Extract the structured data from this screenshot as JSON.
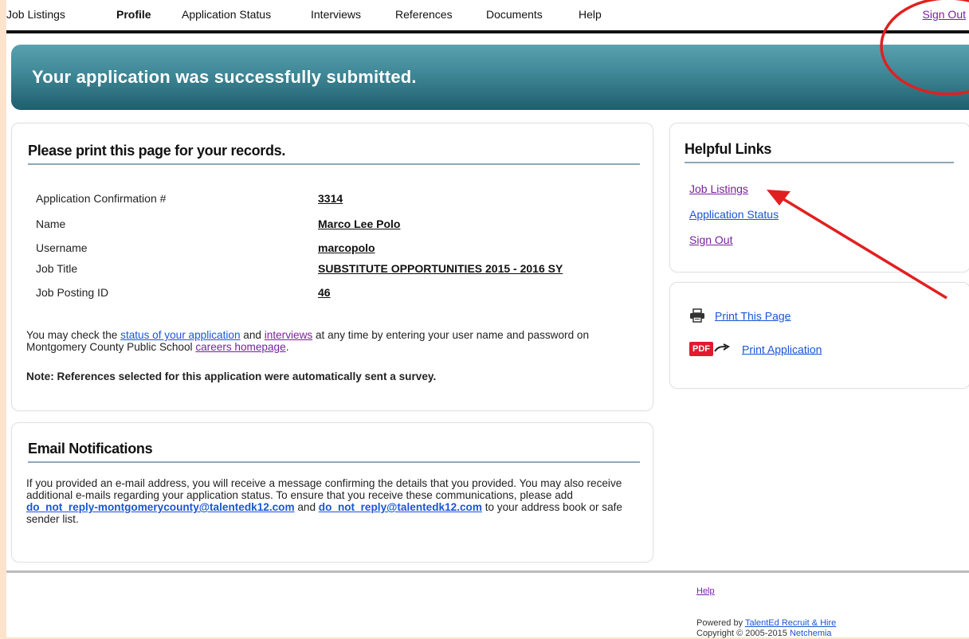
{
  "nav": {
    "items": [
      "Job Listings",
      "Profile",
      "Application Status",
      "Interviews",
      "References",
      "Documents",
      "Help"
    ],
    "sign_out": "Sign Out"
  },
  "banner": {
    "message": "Your application was successfully submitted."
  },
  "records": {
    "title": "Please print this page for your records.",
    "rows": [
      {
        "label": "Application Confirmation #",
        "value": "3314"
      },
      {
        "label": "Name",
        "value": "Marco Lee Polo"
      },
      {
        "label": "Username",
        "value": "marcopolo"
      },
      {
        "label": "Job Title",
        "value": "SUBSTITUTE OPPORTUNITIES 2015 - 2016 SY"
      },
      {
        "label": "Job Posting ID",
        "value": "46"
      }
    ],
    "info": {
      "part1": "You may check the ",
      "status_link": "status of your application",
      "part2": " and ",
      "interviews_link": "interviews",
      "part3": " at any time by entering your user name and password on Montgomery County Public School ",
      "careers_link": "careers homepage",
      "part4": "."
    },
    "note": "Note: References selected for this application were automatically sent a survey."
  },
  "email": {
    "title": "Email Notifications",
    "text1": "If you provided an e-mail address, you will receive a message confirming the details that you provided. You may also receive additional e-mails regarding your application status. To ensure that you receive these communications, please add ",
    "address1": "do_not_reply-montgomerycounty@talentedk12.com",
    "text2": " and ",
    "address2": "do_not_reply@talentedk12.com",
    "text3": " to your address book or safe sender list."
  },
  "helpful": {
    "title": "Helpful Links",
    "links": [
      "Job Listings",
      "Application Status",
      "Sign Out"
    ]
  },
  "print": {
    "print_page": "Print This Page",
    "pdf_badge": "PDF",
    "print_application": "Print Application"
  },
  "footer": {
    "help": "Help",
    "powered_by": "Powered by ",
    "product": "TalentEd Recruit & Hire",
    "copyright": "Copyright © 2005-2015 ",
    "company": "Netchemia"
  },
  "colors": {
    "banner": "#3f8796",
    "annotation": "#e02020",
    "link": "#1a55d6",
    "visited": "#7a1fa2"
  }
}
